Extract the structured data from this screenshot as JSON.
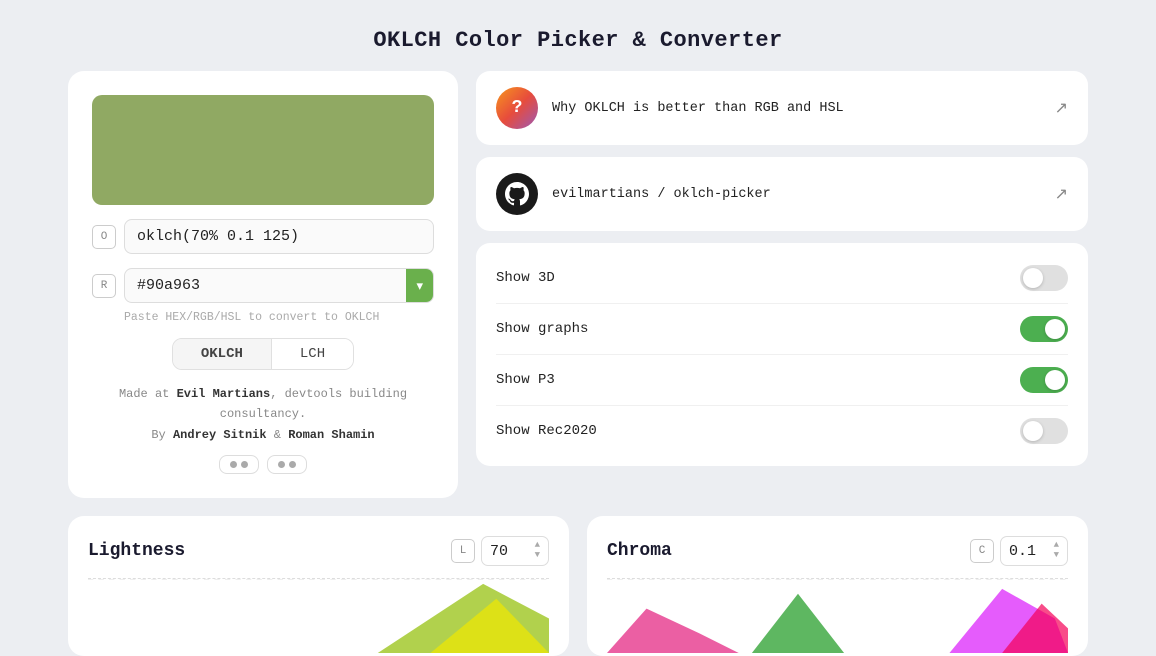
{
  "page": {
    "title": "OKLCH Color Picker & Converter"
  },
  "left": {
    "color_preview_bg": "#90a963",
    "oklch_value": "oklch(70% 0.1 125)",
    "oklch_badge": "O",
    "hex_value": "#90a963",
    "hex_badge": "R",
    "hint": "Paste HEX/RGB/HSL to convert to OKLCH",
    "tab_oklch": "OKLCH",
    "tab_lch": "LCH",
    "credit_line1": "Made at",
    "credit_bold1": "Evil Martians",
    "credit_line2": ", devtools building consultancy.",
    "credit_by": "By",
    "credit_bold2": "Andrey Sitnik",
    "credit_and": "&",
    "credit_bold3": "Roman Shamin"
  },
  "right": {
    "info_card": {
      "question_mark": "?",
      "text": "Why OKLCH is better than RGB and HSL",
      "external_icon": "↗"
    },
    "github_card": {
      "text": "evilmartians / oklch-picker",
      "external_icon": "↗"
    },
    "toggles": [
      {
        "label": "Show 3D",
        "state": "off"
      },
      {
        "label": "Show graphs",
        "state": "on"
      },
      {
        "label": "Show P3",
        "state": "on"
      },
      {
        "label": "Show Rec2020",
        "state": "off"
      }
    ]
  },
  "lightness": {
    "title": "Lightness",
    "badge": "L",
    "value": "70",
    "spinner_up": "▲",
    "spinner_down": "▼"
  },
  "chroma": {
    "title": "Chroma",
    "badge": "C",
    "value": "0.1",
    "spinner_up": "▲",
    "spinner_down": "▼"
  }
}
